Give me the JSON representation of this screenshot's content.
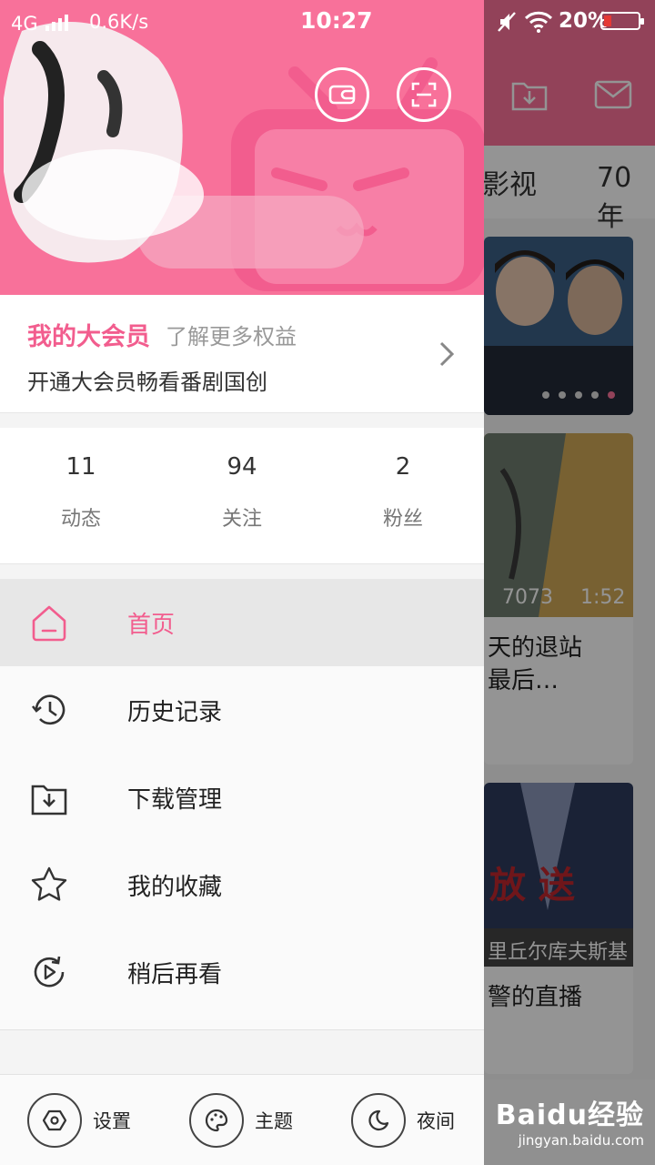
{
  "status_bar": {
    "network": "4G",
    "speed": "0.6K/s",
    "time": "10:27",
    "battery": "20%"
  },
  "background": {
    "tabs": [
      "影视",
      "70年"
    ],
    "card2": {
      "views": "7073",
      "duration": "1:52",
      "title_line1": "天的退站",
      "title_line2": "最后…"
    },
    "card3": {
      "overlay": "放 送",
      "caption": "里丘尔库夫斯基",
      "title": "警的直播"
    }
  },
  "drawer": {
    "vip": {
      "title": "我的大会员",
      "more": "了解更多权益",
      "subtitle": "开通大会员畅看番剧国创"
    },
    "stats": [
      {
        "count": "11",
        "label": "动态"
      },
      {
        "count": "94",
        "label": "关注"
      },
      {
        "count": "2",
        "label": "粉丝"
      }
    ],
    "menu": [
      {
        "label": "首页",
        "icon": "home-icon",
        "active": true
      },
      {
        "label": "历史记录",
        "icon": "history-icon"
      },
      {
        "label": "下载管理",
        "icon": "download-icon"
      },
      {
        "label": "我的收藏",
        "icon": "star-icon"
      },
      {
        "label": "稍后再看",
        "icon": "watch-later-icon"
      }
    ],
    "footer": [
      {
        "label": "设置",
        "icon": "settings-icon"
      },
      {
        "label": "主题",
        "icon": "palette-icon"
      },
      {
        "label": "夜间",
        "icon": "moon-icon"
      }
    ]
  },
  "watermark": {
    "brand": "Baidu经验",
    "url": "jingyan.baidu.com"
  },
  "colors": {
    "brand_pink": "#fb7299",
    "accent_text": "#f25d8e"
  }
}
